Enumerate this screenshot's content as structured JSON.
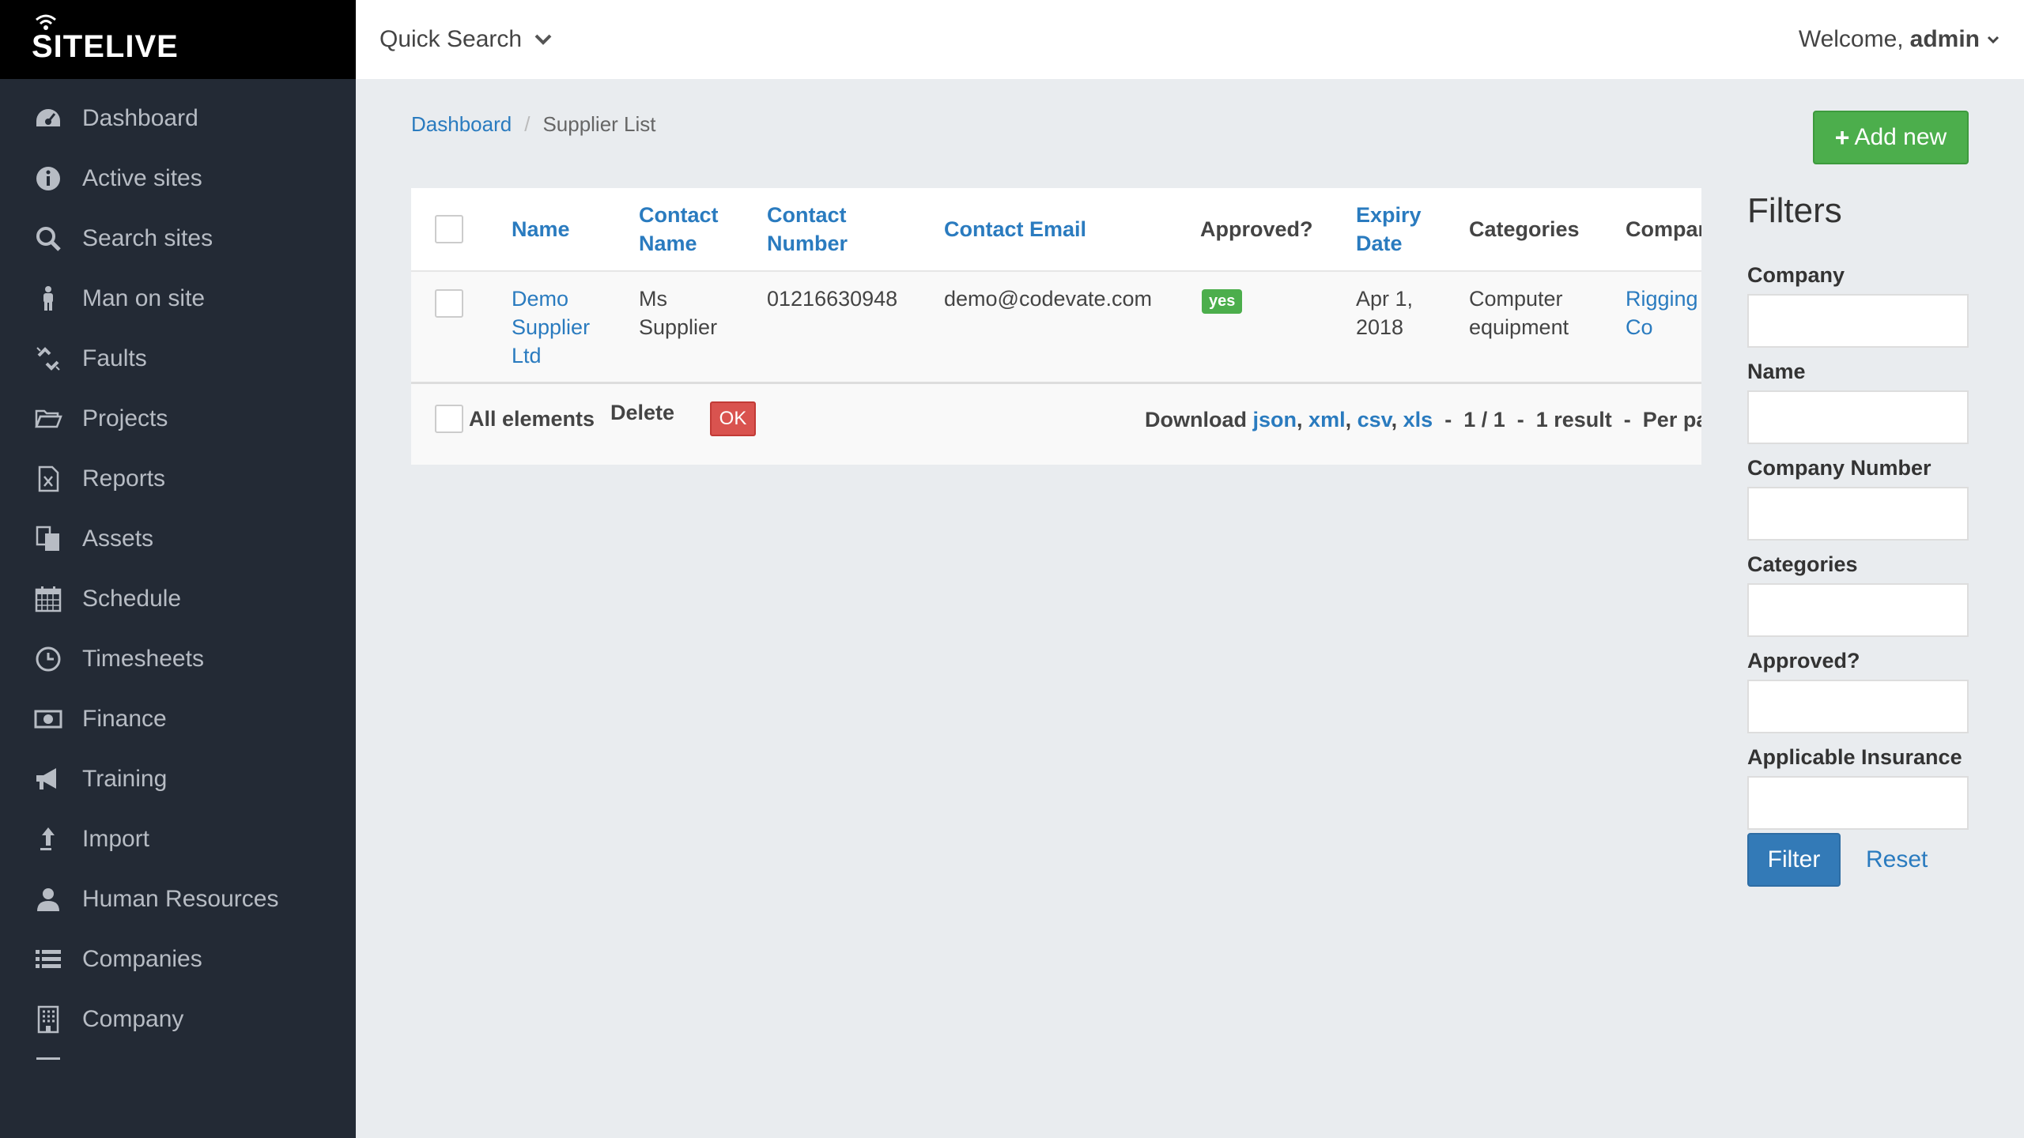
{
  "brand": {
    "name": "SITELIVE"
  },
  "sidebar": {
    "items": [
      {
        "label": "Dashboard",
        "icon": "dashboard-icon"
      },
      {
        "label": "Active sites",
        "icon": "info-icon"
      },
      {
        "label": "Search sites",
        "icon": "search-icon"
      },
      {
        "label": "Man on site",
        "icon": "person-icon"
      },
      {
        "label": "Faults",
        "icon": "broken-link-icon"
      },
      {
        "label": "Projects",
        "icon": "folder-icon"
      },
      {
        "label": "Reports",
        "icon": "excel-file-icon"
      },
      {
        "label": "Assets",
        "icon": "copy-icon"
      },
      {
        "label": "Schedule",
        "icon": "calendar-icon"
      },
      {
        "label": "Timesheets",
        "icon": "clock-icon"
      },
      {
        "label": "Finance",
        "icon": "money-icon"
      },
      {
        "label": "Training",
        "icon": "megaphone-icon"
      },
      {
        "label": "Import",
        "icon": "upload-arrow-icon"
      },
      {
        "label": "Human Resources",
        "icon": "user-icon"
      },
      {
        "label": "Companies",
        "icon": "list-icon"
      },
      {
        "label": "Company",
        "icon": "building-icon"
      }
    ]
  },
  "topbar": {
    "quick_search": "Quick Search",
    "welcome": "Welcome,",
    "user": "admin"
  },
  "breadcrumb": {
    "home": "Dashboard",
    "separator": "/",
    "current": "Supplier List"
  },
  "add_new": {
    "label": "Add new"
  },
  "table": {
    "headers": {
      "name": "Name",
      "contact_name_1": "Contact",
      "contact_name_2": "Name",
      "contact_number_1": "Contact",
      "contact_number_2": "Number",
      "contact_email": "Contact Email",
      "approved": "Approved?",
      "expiry_1": "Expiry",
      "expiry_2": "Date",
      "categories": "Categories",
      "company": "Compar"
    },
    "row": {
      "name_1": "Demo",
      "name_2": "Supplier",
      "name_3": "Ltd",
      "contact_name_1": "Ms",
      "contact_name_2": "Supplier",
      "contact_number": "01216630948",
      "contact_email": "demo@codevate.com",
      "approved": "yes",
      "expiry_1": "Apr 1,",
      "expiry_2": "2018",
      "categories_1": "Computer",
      "categories_2": "equipment",
      "company_1": "Rigging",
      "company_2": "Co"
    },
    "footer": {
      "all_elements": "All elements",
      "action": "Delete",
      "ok": "OK",
      "download": "Download",
      "json": "json",
      "xml": "xml",
      "csv": "csv",
      "xls": "xls",
      "pagination": "1 / 1",
      "result": "1 result",
      "per_page": "Per pag"
    }
  },
  "filters": {
    "title": "Filters",
    "fields": [
      "Company",
      "Name",
      "Company Number",
      "Categories",
      "Approved?",
      "Applicable Insurance"
    ],
    "filter_button": "Filter",
    "reset": "Reset"
  }
}
